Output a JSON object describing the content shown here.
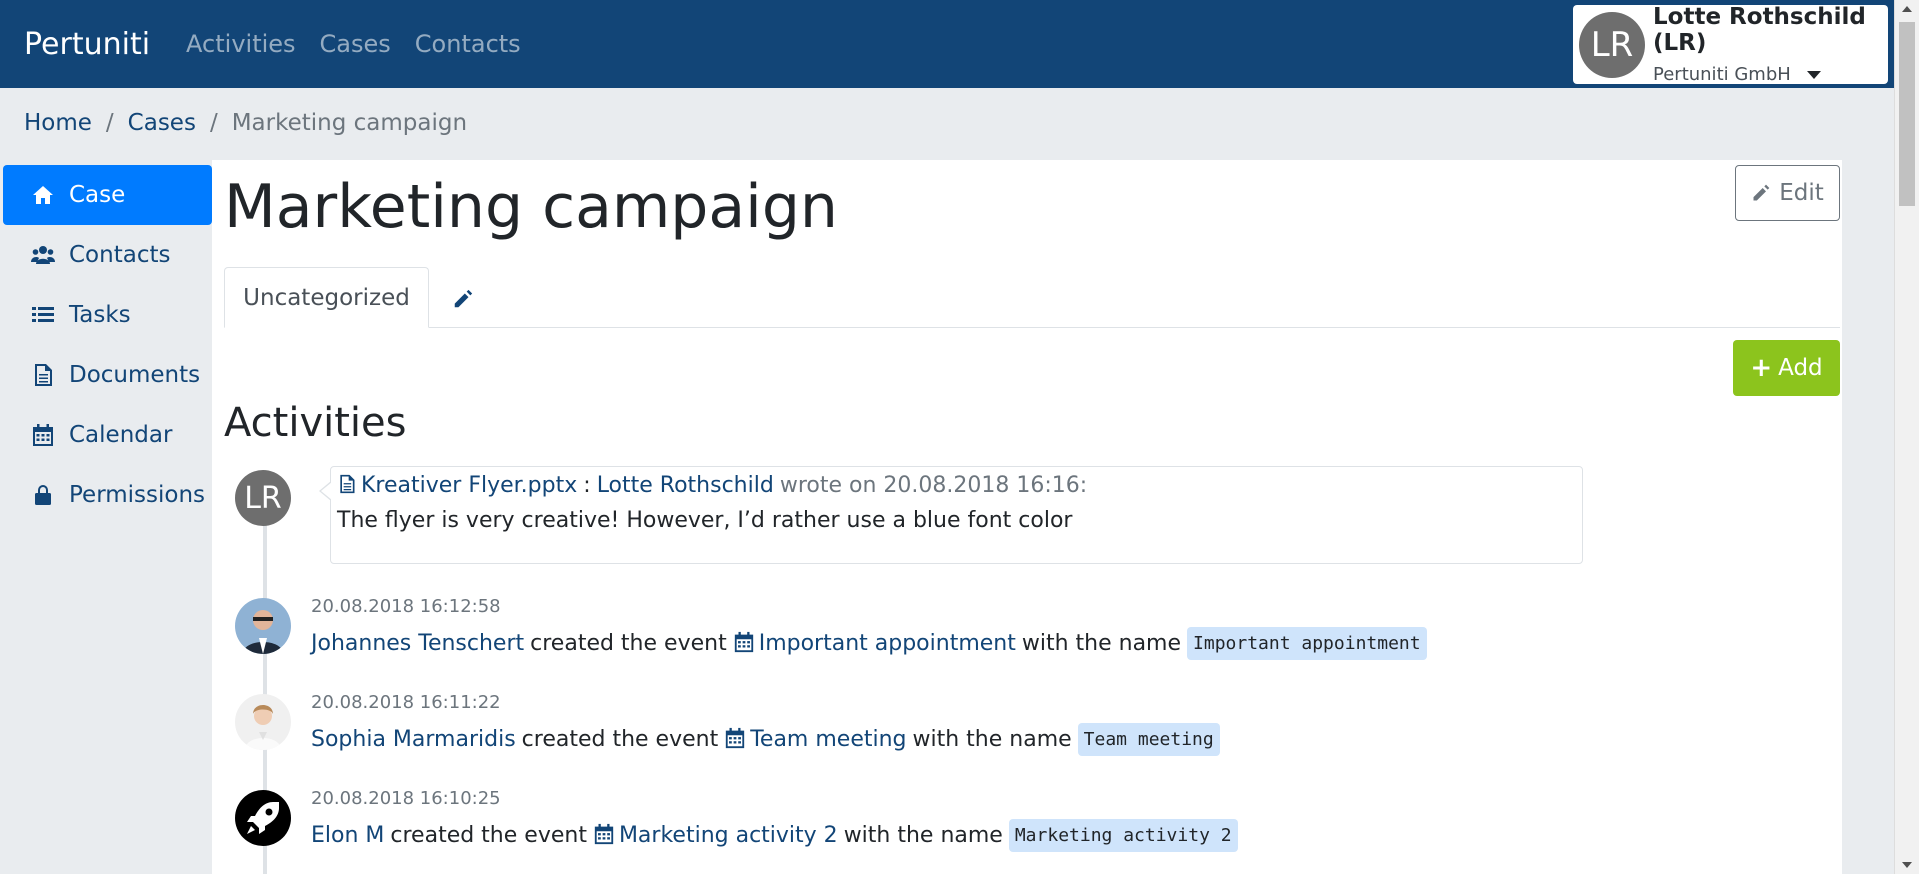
{
  "navbar": {
    "brand": "Pertuniti",
    "links": [
      "Activities",
      "Cases",
      "Contacts"
    ],
    "user": {
      "initials": "LR",
      "name": "Lotte Rothschild (LR)",
      "org": "Pertuniti GmbH"
    }
  },
  "breadcrumb": {
    "home": "Home",
    "sep": "/",
    "cases": "Cases",
    "current": "Marketing campaign"
  },
  "sidebar": {
    "items": [
      {
        "label": "Case",
        "icon": "home-icon"
      },
      {
        "label": "Contacts",
        "icon": "users-icon"
      },
      {
        "label": "Tasks",
        "icon": "list-icon"
      },
      {
        "label": "Documents",
        "icon": "document-icon"
      },
      {
        "label": "Calendar",
        "icon": "calendar-icon"
      },
      {
        "label": "Permissions",
        "icon": "lock-icon"
      }
    ]
  },
  "main": {
    "title": "Marketing campaign",
    "edit_label": "Edit",
    "tab_label": "Uncategorized",
    "add_label": "Add",
    "activities_title": "Activities"
  },
  "comment": {
    "author_initials": "LR",
    "file": "Kreativer Flyer.pptx",
    "colon": ":",
    "author": "Lotte Rothschild",
    "wrote": "wrote on 20.08.2018 16:16:",
    "body": "The flyer is very creative! However, I’d rather use a blue font color"
  },
  "events": [
    {
      "time": "20.08.2018 16:12:58",
      "actor": "Johannes Tenschert",
      "action": "created the event",
      "event": "Important appointment",
      "with_name": "with the name",
      "tag": "Important appointment"
    },
    {
      "time": "20.08.2018 16:11:22",
      "actor": "Sophia Marmaridis",
      "action": "created the event",
      "event": "Team meeting",
      "with_name": "with the name",
      "tag": "Team meeting"
    },
    {
      "time": "20.08.2018 16:10:25",
      "actor": "Elon M",
      "action": "created the event",
      "event": "Marketing activity 2",
      "with_name": "with the name",
      "tag": "Marketing activity 2"
    }
  ],
  "colors": {
    "navbar": "#124577",
    "active": "#007bff",
    "add": "#8cc41d",
    "tag": "#cfe4fb"
  }
}
